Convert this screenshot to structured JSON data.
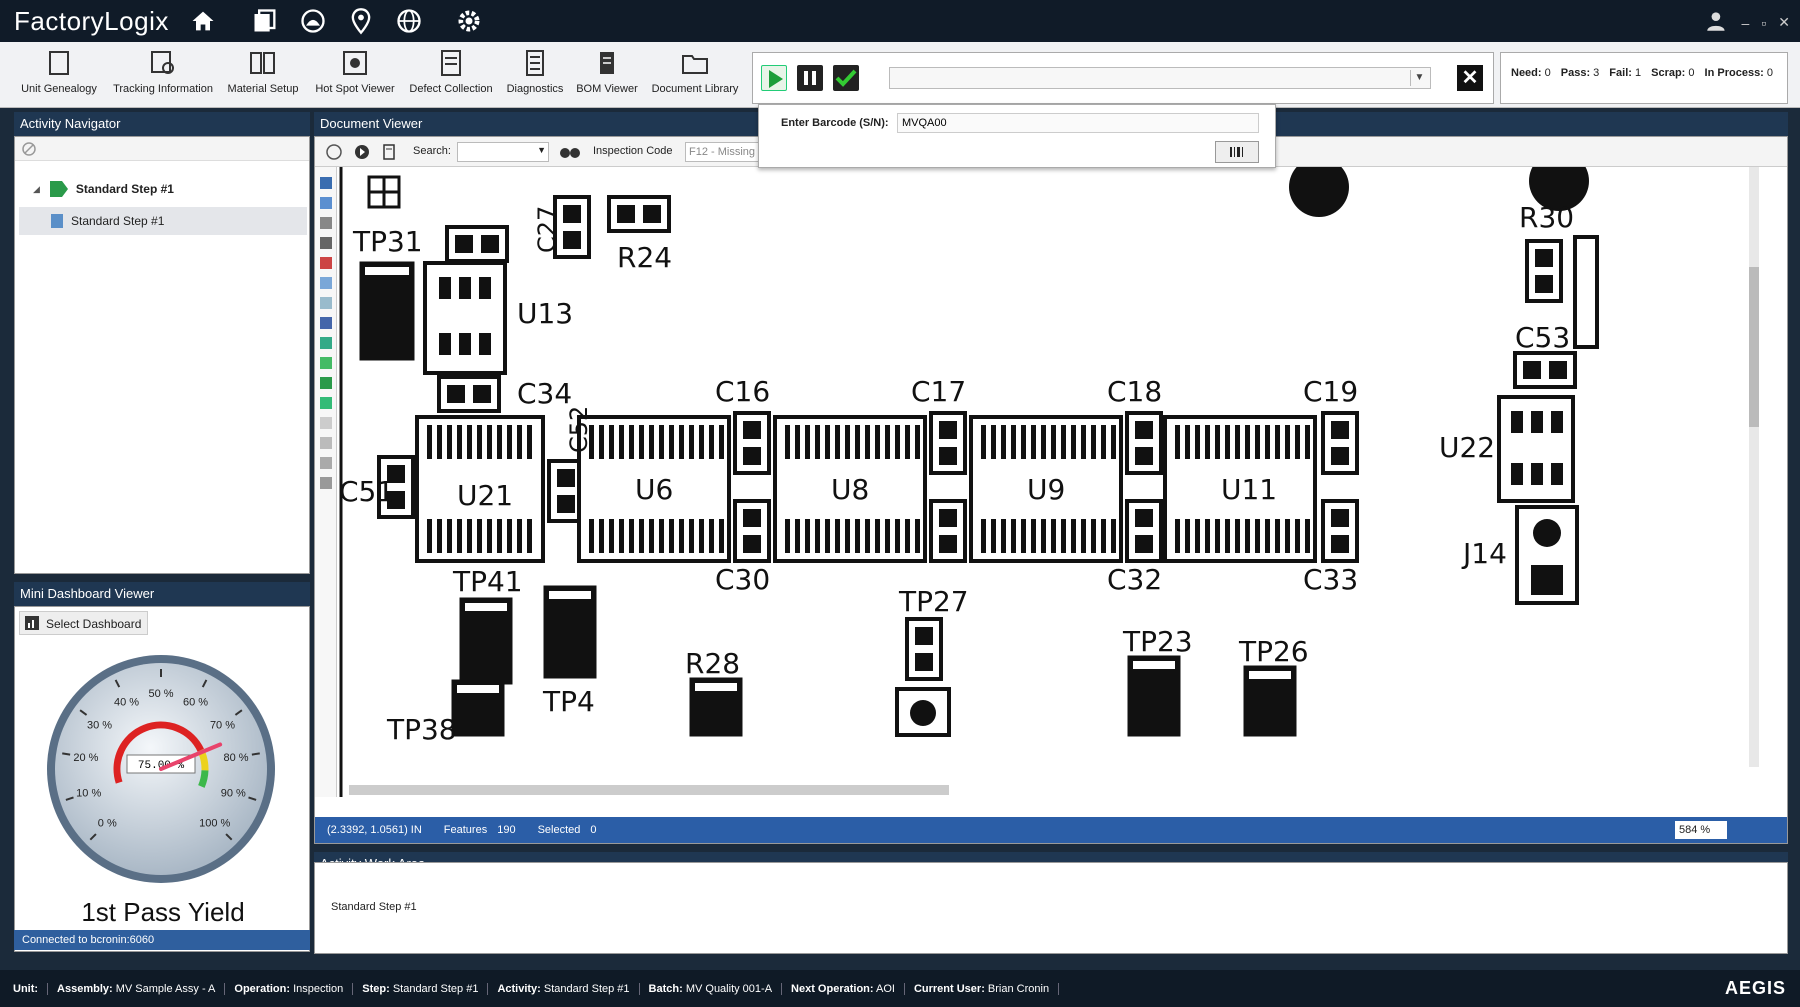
{
  "app": {
    "title": "FactoryLogix"
  },
  "ribbon": [
    "Unit Genealogy",
    "Tracking Information",
    "Material Setup",
    "Hot Spot Viewer",
    "Defect Collection",
    "Diagnostics",
    "BOM Viewer",
    "Document Library"
  ],
  "counts": {
    "need_label": "Need:",
    "need": "0",
    "pass_label": "Pass:",
    "pass": "3",
    "fail_label": "Fail:",
    "fail": "1",
    "scrap_label": "Scrap:",
    "scrap": "0",
    "inproc_label": "In Process:",
    "inproc": "0"
  },
  "barcode": {
    "label": "Enter Barcode (S/N):",
    "value": "MVQA00"
  },
  "nav": {
    "title": "Activity Navigator",
    "parent": "Standard Step #1",
    "child": "Standard Step #1"
  },
  "dashboard": {
    "title": "Mini Dashboard Viewer",
    "select_label": "Select Dashboard",
    "gauge_title": "1st Pass Yield",
    "gauge_value": "75.00 %",
    "gauge_value_num": 75,
    "ticks": [
      "0 %",
      "10 %",
      "20 %",
      "30 %",
      "40 %",
      "50 %",
      "60 %",
      "70 %",
      "80 %",
      "90 %",
      "100 %"
    ],
    "connection": "Connected to bcronin:6060"
  },
  "doc": {
    "title": "Document Viewer",
    "search_label": "Search:",
    "inspection_label": "Inspection Code",
    "inspection_value": "F12 - Missing",
    "status": {
      "coords": "(2.3392, 1.0561) IN",
      "features_label": "Features",
      "features": "190",
      "selected_label": "Selected",
      "selected": "0",
      "zoom": "584 %"
    }
  },
  "pcb_labels": [
    "TP31",
    "C27",
    "R24",
    "U13",
    "C34",
    "R30",
    "C53",
    "C16",
    "C17",
    "C18",
    "C19",
    "C52",
    "C51",
    "U21",
    "U6",
    "U8",
    "U9",
    "U11",
    "U22",
    "C30",
    "C32",
    "C33",
    "J14",
    "TP41",
    "TP4",
    "R28",
    "TP27",
    "TP23",
    "TP26",
    "TP38"
  ],
  "work": {
    "title": "Activity Work Area",
    "text": "Standard Step #1"
  },
  "statusbar": {
    "unit_label": "Unit:",
    "unit": "",
    "assembly_label": "Assembly:",
    "assembly": "MV Sample Assy - A",
    "operation_label": "Operation:",
    "operation": "Inspection",
    "step_label": "Step:",
    "step": "Standard Step #1",
    "activity_label": "Activity:",
    "activity": "Standard Step #1",
    "batch_label": "Batch:",
    "batch": "MV Quality 001-A",
    "next_label": "Next Operation:",
    "next": "AOI",
    "user_label": "Current User:",
    "user": "Brian Cronin",
    "brand": "AEGIS"
  }
}
